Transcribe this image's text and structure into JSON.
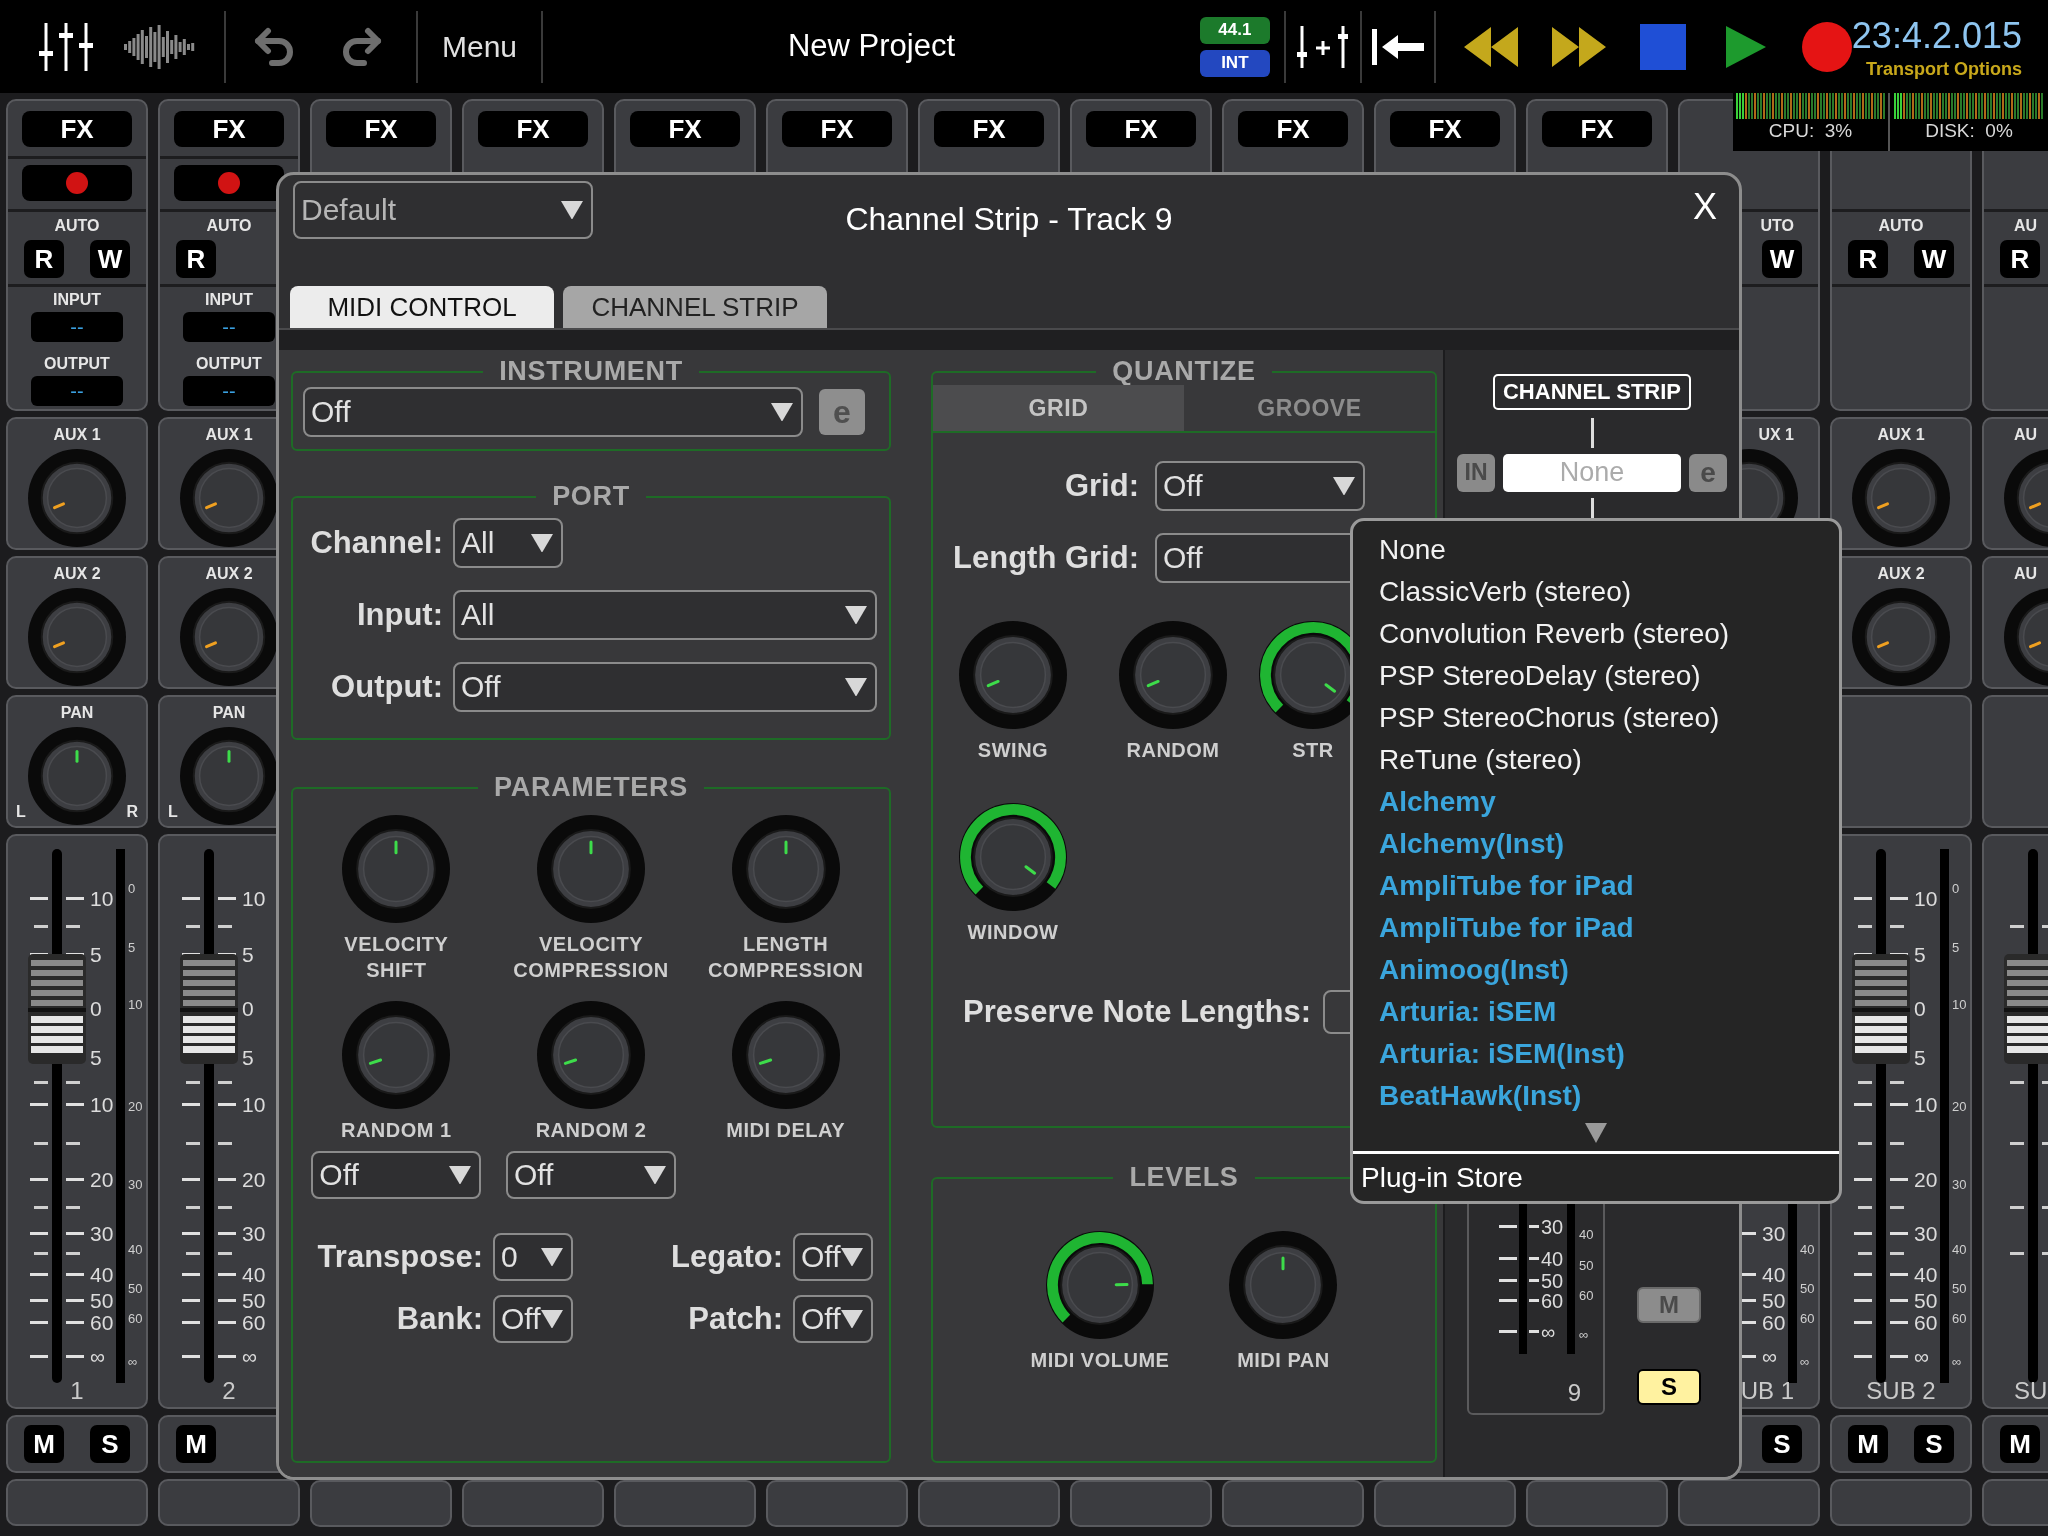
{
  "top_bar": {
    "menu": "Menu",
    "title": "New Project",
    "sample_rate": "44.1",
    "clock": "INT",
    "time": "23:4.2.015",
    "transport_options": "Transport Options"
  },
  "performance": {
    "cpu": "CPU:  3%",
    "disk": "DISK:  0%"
  },
  "strips": [
    {
      "kind": "track",
      "fx": "FX",
      "auto": "AUTO",
      "read": "R",
      "write": "W",
      "input": "INPUT",
      "input_value": "--",
      "output": "OUTPUT",
      "output_value": "--",
      "aux1": {
        "label": "AUX 1"
      },
      "aux2": {
        "label": "AUX 2"
      },
      "pan": {
        "label": "PAN",
        "left": "L",
        "right": "R"
      },
      "fader": {
        "level": 0.7,
        "scale": [
          "10",
          "5",
          "0",
          "5",
          "10",
          "20",
          "30",
          "40",
          "50",
          "60",
          "∞"
        ],
        "meter_scale": [
          "0",
          "5",
          "10",
          "20",
          "30",
          "40",
          "50",
          "60",
          "∞"
        ]
      },
      "name": "1",
      "mute": "M",
      "solo": "S"
    },
    {
      "kind": "track",
      "fx": "FX",
      "auto": "AUTO",
      "read": "R",
      "input": "INPUT",
      "input_value": "--",
      "output": "OUTPUT",
      "output_value": "--",
      "aux1": {
        "label": "AUX 1"
      },
      "aux2": {
        "label": "AUX 2"
      },
      "pan": {
        "label": "PAN",
        "left": "L"
      },
      "fader": {
        "level": 0.7,
        "scale": [
          "10",
          "5",
          "0",
          "5",
          "10",
          "20",
          "30",
          "40",
          "50",
          "60",
          "∞"
        ]
      },
      "name": "2",
      "mute": "M"
    },
    {
      "kind": "covered",
      "fx": "FX"
    },
    {
      "kind": "covered",
      "fx": "FX"
    },
    {
      "kind": "covered",
      "fx": "FX"
    },
    {
      "kind": "covered",
      "fx": "FX"
    },
    {
      "kind": "covered",
      "fx": "FX"
    },
    {
      "kind": "covered",
      "fx": "FX"
    },
    {
      "kind": "covered",
      "fx": "FX"
    },
    {
      "kind": "covered",
      "fx": "FX"
    },
    {
      "kind": "covered",
      "fx": "FX"
    },
    {
      "kind": "bus_cut",
      "auto": "UTO",
      "write": "W",
      "aux1": {
        "label": "UX 1"
      },
      "fader": {
        "scale": [
          "30",
          "40",
          "50",
          "60",
          "∞"
        ],
        "meter_scale": [
          "40",
          "50",
          "60",
          "∞"
        ]
      },
      "name": "UB 1",
      "solo": "S"
    },
    {
      "kind": "bus",
      "auto": "AUTO",
      "read": "R",
      "write": "W",
      "aux1": {
        "label": "AUX 1"
      },
      "aux2": {
        "label": "AUX 2"
      },
      "fader": {
        "level": 0.7,
        "scale": [
          "10",
          "5",
          "0",
          "5",
          "10",
          "20",
          "30",
          "40",
          "50",
          "60",
          "∞"
        ],
        "meter_scale": [
          "0",
          "5",
          "10",
          "20",
          "30",
          "40",
          "50",
          "60",
          "∞"
        ]
      },
      "name": "SUB 2",
      "mute": "M",
      "solo": "S"
    },
    {
      "kind": "bus_edge",
      "auto": "AU",
      "read": "R",
      "aux1": {
        "label": "AU"
      },
      "aux2": {
        "label": "AU"
      },
      "fader": {
        "level": 0.7
      },
      "name": "SU",
      "mute": "M"
    }
  ],
  "dialog": {
    "preset": "Default",
    "title": "Channel Strip - Track 9",
    "close": "X",
    "tabs": [
      {
        "label": "MIDI CONTROL",
        "selected": true
      },
      {
        "label": "CHANNEL STRIP",
        "selected": false
      }
    ],
    "instrument": {
      "legend": "INSTRUMENT",
      "value": "Off",
      "edit": "e"
    },
    "port": {
      "legend": "PORT",
      "fields": [
        {
          "label": "Channel:",
          "value": "All",
          "kind": "short"
        },
        {
          "label": "Input:",
          "value": "All",
          "kind": "wide"
        },
        {
          "label": "Output:",
          "value": "Off",
          "kind": "wide"
        }
      ]
    },
    "parameters": {
      "legend": "PARAMETERS",
      "knobs": [
        {
          "label": "VELOCITY SHIFT"
        },
        {
          "label": "VELOCITY COMPRESSION"
        },
        {
          "label": "LENGTH COMPRESSION"
        },
        {
          "label": "RANDOM 1",
          "select": "Off"
        },
        {
          "label": "RANDOM 2",
          "select": "Off"
        },
        {
          "label": "MIDI DELAY"
        }
      ],
      "fields": [
        {
          "label": "Transpose:",
          "value": "0"
        },
        {
          "label": "Legato:",
          "value": "Off"
        },
        {
          "label": "Bank:",
          "value": "Off"
        },
        {
          "label": "Patch:",
          "value": "Off"
        }
      ]
    },
    "quantize": {
      "legend": "QUANTIZE",
      "tabs": [
        {
          "label": "GRID",
          "selected": true
        },
        {
          "label": "GROOVE",
          "selected": false
        }
      ],
      "grid": {
        "label": "Grid:",
        "value": "Off"
      },
      "length_grid": {
        "label": "Length Grid:",
        "value": "Off"
      },
      "knobs": [
        {
          "label": "SWING",
          "ring": false
        },
        {
          "label": "RANDOM",
          "ring": false
        },
        {
          "label": "STR",
          "ring": true
        },
        {
          "label": "WINDOW",
          "ring": true
        }
      ],
      "preserve": "Preserve Note Lengths:"
    },
    "levels": {
      "legend": "LEVELS",
      "knobs": [
        {
          "label": "MIDI VOLUME",
          "ring": true
        },
        {
          "label": "MIDI PAN",
          "ring": false
        }
      ]
    },
    "strip_panel": {
      "heading": "CHANNEL STRIP",
      "input": "IN",
      "slot": "None",
      "edit": "e",
      "fader_scale": [
        "30",
        "40",
        "50",
        "60",
        "∞"
      ],
      "meter_scale": [
        "40",
        "50",
        "60",
        "∞"
      ],
      "name": "9",
      "mute": {
        "label": "M",
        "on": false
      },
      "solo": {
        "label": "S",
        "on": true
      }
    }
  },
  "plugin_menu": {
    "items": [
      {
        "label": "None",
        "kind": "builtin"
      },
      {
        "label": "ClassicVerb (stereo)",
        "kind": "builtin"
      },
      {
        "label": "Convolution Reverb (stereo)",
        "kind": "builtin"
      },
      {
        "label": "PSP StereoDelay (stereo)",
        "kind": "builtin"
      },
      {
        "label": "PSP StereoChorus (stereo)",
        "kind": "builtin"
      },
      {
        "label": "ReTune (stereo)",
        "kind": "builtin"
      },
      {
        "label": "Alchemy",
        "kind": "external"
      },
      {
        "label": "Alchemy(Inst)",
        "kind": "external"
      },
      {
        "label": "AmpliTube for iPad",
        "kind": "external"
      },
      {
        "label": "AmpliTube for iPad",
        "kind": "external"
      },
      {
        "label": "Animoog(Inst)",
        "kind": "external"
      },
      {
        "label": "Arturia: iSEM",
        "kind": "external"
      },
      {
        "label": "Arturia: iSEM(Inst)",
        "kind": "external"
      },
      {
        "label": "BeatHawk(Inst)",
        "kind": "external"
      }
    ],
    "footer": "Plug-in Store"
  }
}
